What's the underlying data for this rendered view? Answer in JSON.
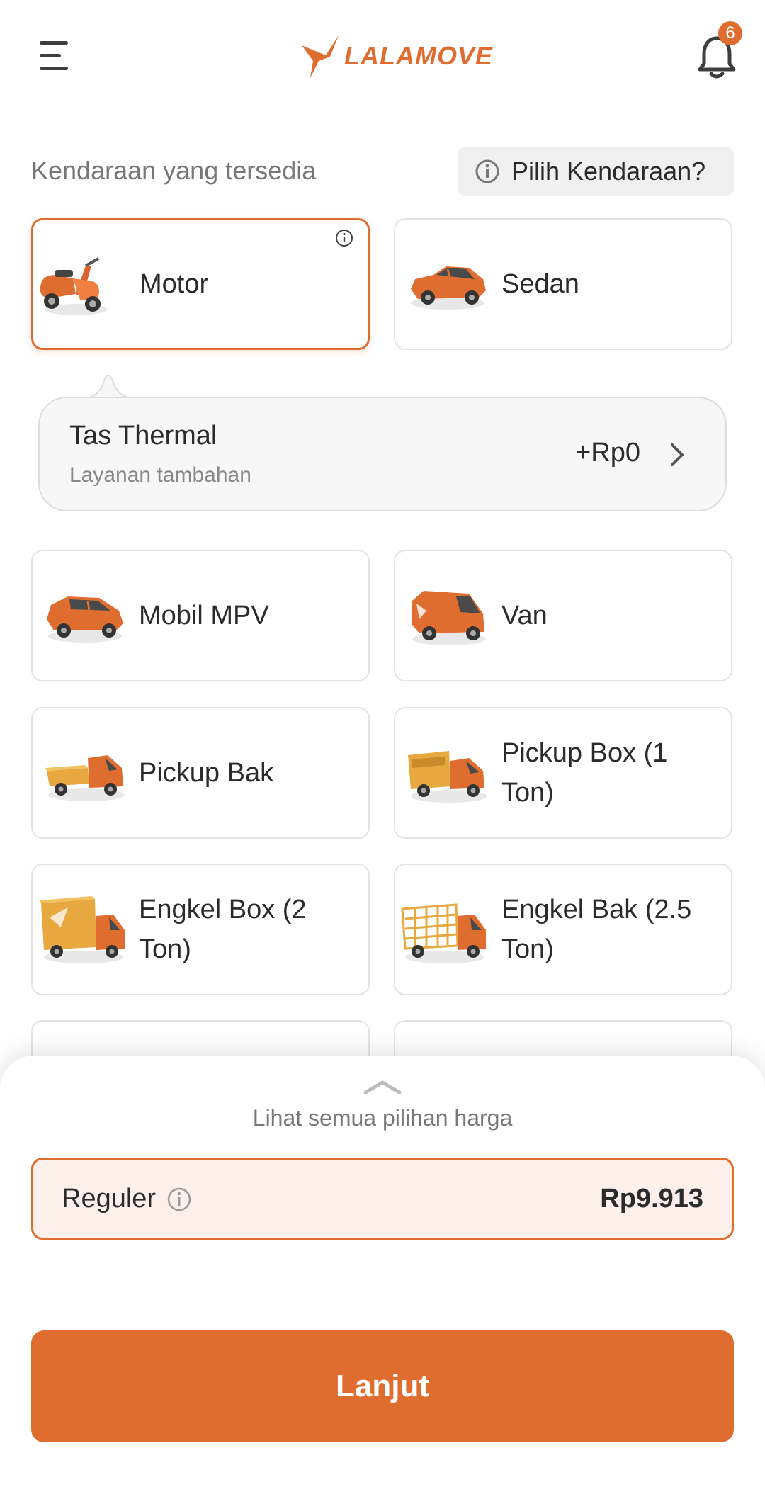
{
  "header": {
    "logo_text": "LALAMOVE",
    "notification_count": "6",
    "brand_color": "#e06d30"
  },
  "vehicles_section": {
    "title": "Kendaraan yang tersedia",
    "help_button": "Pilih Kendaraan?"
  },
  "vehicles": [
    {
      "label": "Motor",
      "icon": "scooter",
      "selected": true
    },
    {
      "label": "Sedan",
      "icon": "sedan"
    },
    {
      "label": "Mobil MPV",
      "icon": "mpv"
    },
    {
      "label": "Van",
      "icon": "van"
    },
    {
      "label": "Pickup Bak",
      "icon": "pickup-bak"
    },
    {
      "label": "Pickup Box (1 Ton)",
      "icon": "pickup-box"
    },
    {
      "label": "Engkel Box (2 Ton)",
      "icon": "engkel-box"
    },
    {
      "label": "Engkel Bak (2.5 Ton)",
      "icon": "engkel-bak"
    }
  ],
  "addon": {
    "title": "Tas Thermal",
    "subtitle": "Layanan tambahan",
    "price": "+Rp0"
  },
  "bottom_sheet": {
    "see_all": "Lihat semua pilihan harga",
    "option_name": "Reguler",
    "option_price": "Rp9.913",
    "continue_button": "Lanjut"
  }
}
